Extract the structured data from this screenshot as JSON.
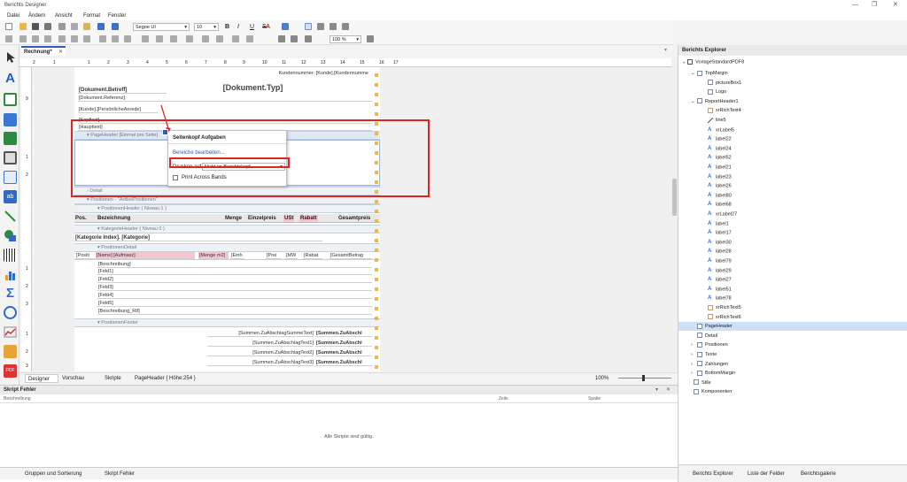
{
  "window": {
    "title": "Berichts Designer",
    "controls": [
      "—",
      "❐",
      "✕"
    ]
  },
  "menu": [
    "Datei",
    "Ändern",
    "Ansicht",
    "Format",
    "Fenster"
  ],
  "toolbar": {
    "font_name": "Segoe UI",
    "font_size": "10",
    "bold": "B",
    "italic": "I",
    "underline": "U",
    "strike": "S",
    "font_color": "A",
    "zoom": "100 %"
  },
  "doc_tab": {
    "label": "Rechnung*",
    "close": "✕"
  },
  "ruler_h": [
    "2",
    "1",
    "1",
    "2",
    "3",
    "4",
    "5",
    "6",
    "7",
    "8",
    "9",
    "10",
    "11",
    "12",
    "13",
    "14",
    "15",
    "16",
    "17",
    "18"
  ],
  "ruler_v": [
    "9",
    "1",
    "2",
    "1",
    "2",
    "3",
    "1",
    "2",
    "3"
  ],
  "report": {
    "kunden_nr": "Kundennummer: [Kunde].[Kundennumme",
    "betreff": "[Dokument.Betreff]",
    "referenz": "[Dokument.Referenz]",
    "dokument_typ": "[Dokument.Typ]",
    "anrede": "[Kunde].[PersönlicheAnrede]",
    "kopftext": "[Kopftext]",
    "haupttext": "[Haupttext]",
    "pageheader_band": "PageHeader [Einmal pro Seite]",
    "detail_band": "Detail",
    "positionen_band": "Positionen - \"ArtikelPositionen\"",
    "positionen_header_band": "PositionenHeader ( Niveau 1 )",
    "col_headers": [
      "Pos.",
      "Bezeichnung",
      "Menge",
      "Einzelpreis",
      "USt",
      "Rabatt",
      "Gesamtpreis"
    ],
    "kategorie_header_band": "KategorieHeader ( Niveau 0 )",
    "kategorie_index": "[Kategorie Index]. [Kategorie]",
    "positionen_detail_band": "PositionenDetail",
    "detail_fields": [
      "[Positi",
      "[Name] [Aufmasz]",
      "[Menge",
      "m2]",
      "[Einh",
      "[Prei",
      "[MW",
      "[Rabat",
      "[GesamtBetrag"
    ],
    "lines": [
      "[Beschreibung]",
      "[Feld1]",
      "[Feld2]",
      "[Feld3]",
      "[Feld4]",
      "[Feld5]",
      "[Beschreibung_Rtf]"
    ],
    "positionen_footer_band": "PositionenFooter",
    "summen": [
      {
        "label": "[Summen.ZuAbschlagSummeText]",
        "value": "[Summen.ZuAbschl"
      },
      {
        "label": "[Summen.ZuAbschlagText1]",
        "value": "[Summen.ZuAbschl"
      },
      {
        "label": "[Summen.ZuAbschlagText2]",
        "value": "[Summen.ZuAbschl"
      },
      {
        "label": "[Summen.ZuAbschlagText3]",
        "value": "[Summen.ZuAbschl"
      }
    ]
  },
  "popup": {
    "title": "Seitenkopf Aufgaben",
    "link": "Bereiche bearbeiten...",
    "print_on_label": "Drucken auf",
    "print_on_value": "Nicht im Berichtskopf",
    "checkbox_label": "Print Across Bands"
  },
  "bottom_tabs": {
    "designer": "Designer",
    "preview": "Vorschau",
    "scripts": "Skripte",
    "status": "PageHeader { Höhe:254 }",
    "zoom": "100%"
  },
  "errors": {
    "title": "Skript Fehler",
    "col_desc": "Beschreibung",
    "col_line": "Zeile",
    "col_col": "Spalte",
    "message": "Alle Skripte sind gültig.",
    "tab_groups": "Gruppen und Sortierung",
    "tab_errors": "Skript Fehler"
  },
  "explorer": {
    "title": "Berichts Explorer",
    "root": "VorlageStandardPDF8",
    "items": [
      {
        "label": "TopMargin",
        "level": 1,
        "kind": "band",
        "expand": "⌄"
      },
      {
        "label": "pictureBox1",
        "level": 2,
        "kind": "pic",
        "expand": ""
      },
      {
        "label": "Logo",
        "level": 2,
        "kind": "pic",
        "expand": ""
      },
      {
        "label": "ReportHeader1",
        "level": 1,
        "kind": "band",
        "expand": "⌄"
      },
      {
        "label": "xrRichText4",
        "level": 2,
        "kind": "rich",
        "expand": ""
      },
      {
        "label": "line5",
        "level": 2,
        "kind": "line",
        "expand": ""
      },
      {
        "label": "xrLabel5",
        "level": 2,
        "kind": "label",
        "expand": ""
      },
      {
        "label": "label22",
        "level": 2,
        "kind": "label",
        "expand": ""
      },
      {
        "label": "label24",
        "level": 2,
        "kind": "label",
        "expand": ""
      },
      {
        "label": "label52",
        "level": 2,
        "kind": "label",
        "expand": ""
      },
      {
        "label": "label21",
        "level": 2,
        "kind": "label",
        "expand": ""
      },
      {
        "label": "label23",
        "level": 2,
        "kind": "label",
        "expand": ""
      },
      {
        "label": "label26",
        "level": 2,
        "kind": "label",
        "expand": ""
      },
      {
        "label": "label80",
        "level": 2,
        "kind": "label",
        "expand": ""
      },
      {
        "label": "label68",
        "level": 2,
        "kind": "label",
        "expand": ""
      },
      {
        "label": "xrLabel27",
        "level": 2,
        "kind": "label",
        "expand": ""
      },
      {
        "label": "label1",
        "level": 2,
        "kind": "label",
        "expand": ""
      },
      {
        "label": "label17",
        "level": 2,
        "kind": "label",
        "expand": ""
      },
      {
        "label": "label30",
        "level": 2,
        "kind": "label",
        "expand": ""
      },
      {
        "label": "label28",
        "level": 2,
        "kind": "label",
        "expand": ""
      },
      {
        "label": "label79",
        "level": 2,
        "kind": "label",
        "expand": ""
      },
      {
        "label": "label29",
        "level": 2,
        "kind": "label",
        "expand": ""
      },
      {
        "label": "label27",
        "level": 2,
        "kind": "label",
        "expand": ""
      },
      {
        "label": "label51",
        "level": 2,
        "kind": "label",
        "expand": ""
      },
      {
        "label": "label78",
        "level": 2,
        "kind": "label",
        "expand": ""
      },
      {
        "label": "xrRichText5",
        "level": 2,
        "kind": "rich",
        "expand": ""
      },
      {
        "label": "xrRichText6",
        "level": 2,
        "kind": "rich",
        "expand": ""
      },
      {
        "label": "PageHeader",
        "level": 1,
        "kind": "band",
        "expand": "",
        "selected": true
      },
      {
        "label": "Detail",
        "level": 1,
        "kind": "band",
        "expand": ""
      },
      {
        "label": "Positionen",
        "level": 1,
        "kind": "band",
        "expand": "›"
      },
      {
        "label": "Texte",
        "level": 1,
        "kind": "band",
        "expand": "›"
      },
      {
        "label": "Zahlungen",
        "level": 1,
        "kind": "band",
        "expand": "›"
      },
      {
        "label": "BottomMargin",
        "level": 1,
        "kind": "band",
        "expand": "›"
      },
      {
        "label": "Stile",
        "level": 0,
        "kind": "style",
        "expand": ""
      },
      {
        "label": "Komponenten",
        "level": 0,
        "kind": "comp",
        "expand": ""
      }
    ],
    "tabs": [
      "Berichts Explorer",
      "Liste der Felder",
      "Berichtsgalerie"
    ]
  },
  "colors": {
    "accent": "#2b5fb3",
    "highlight_red": "#e02424",
    "selected": "#cde0f7",
    "band_bg": "#eef1f6"
  }
}
